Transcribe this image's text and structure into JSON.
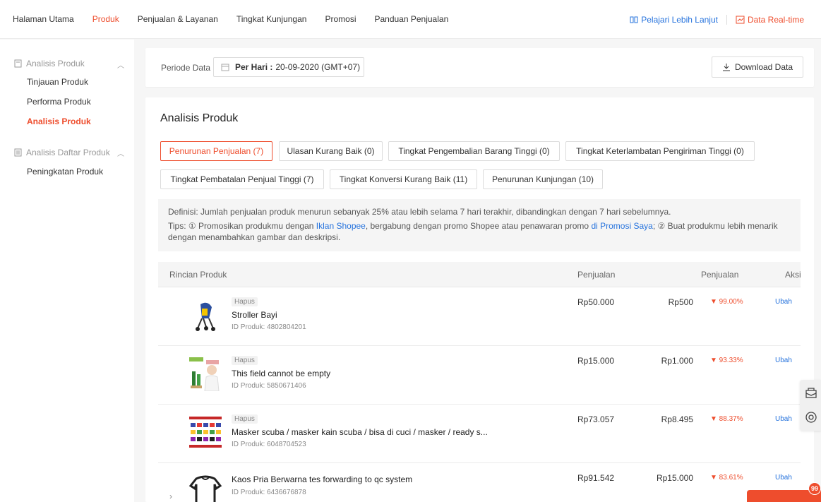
{
  "topnav": {
    "items": [
      "Halaman Utama",
      "Produk",
      "Penjualan & Layanan",
      "Tingkat Kunjungan",
      "Promosi",
      "Panduan Penjualan"
    ],
    "active_index": 1,
    "learn_more": "Pelajari Lebih Lanjut",
    "realtime": "Data Real-time"
  },
  "sidebar": {
    "group1": "Analisis Produk",
    "group1_items": [
      "Tinjauan Produk",
      "Performa Produk",
      "Analisis Produk"
    ],
    "group2": "Analisis Daftar Produk",
    "group2_items": [
      "Peningkatan Produk"
    ]
  },
  "period": {
    "label": "Periode Data",
    "date_label": "Per Hari :",
    "date_value": "20-09-2020 (GMT+07)",
    "download": "Download Data"
  },
  "main": {
    "title": "Analisis Produk",
    "chips": [
      "Penurunan Penjualan (7)",
      "Ulasan Kurang Baik (0)",
      "Tingkat Pengembalian Barang Tinggi (0)",
      "Tingkat Keterlambatan Pengiriman Tinggi (0)",
      "Tingkat Pembatalan Penjual Tinggi (7)",
      "Tingkat Konversi Kurang Baik (11)",
      "Penurunan Kunjungan (10)"
    ],
    "active_chip": 0,
    "definition_label": "Definisi:",
    "definition_text": "Jumlah penjualan produk menurun sebanyak 25% atau lebih selama 7 hari terakhir, dibandingkan dengan 7 hari sebelumnya.",
    "tips_label": "Tips:",
    "tips_part1": "① Promosikan produkmu dengan",
    "tips_link1": "Iklan Shopee",
    "tips_part2": ", bergabung dengan promo Shopee atau penawaran promo",
    "tips_link2": "di Promosi Saya",
    "tips_part3": "; ② Buat produkmu lebih menarik dengan menambahkan gambar dan deskripsi."
  },
  "table": {
    "headers": [
      "Rincian Produk",
      "Penjualan",
      "Penjualan",
      "Aksi"
    ],
    "rows": [
      {
        "badge": "Hapus",
        "name": "Stroller Bayi",
        "id": "ID Produk: 4802804201",
        "sales_prev": "Rp50.000",
        "sales_now": "Rp500",
        "change": "▼ 99.00%",
        "action": "Ubah"
      },
      {
        "badge": "Hapus",
        "name": "This field cannot be empty",
        "id": "ID Produk: 5850671406",
        "sales_prev": "Rp15.000",
        "sales_now": "Rp1.000",
        "change": "▼ 93.33%",
        "action": "Ubah"
      },
      {
        "badge": "Hapus",
        "name": "Masker scuba / masker kain scuba / bisa di cuci / masker / ready s...",
        "id": "ID Produk: 6048704523",
        "sales_prev": "Rp73.057",
        "sales_now": "Rp8.495",
        "change": "▼ 88.37%",
        "action": "Ubah"
      },
      {
        "badge": "",
        "name": "Kaos Pria Berwarna tes forwarding to qc system",
        "id": "ID Produk: 6436676878",
        "sales_prev": "Rp91.542",
        "sales_now": "Rp15.000",
        "change": "▼ 83.61%",
        "action": "Ubah"
      }
    ]
  },
  "chat": {
    "badge_count": "99"
  },
  "colors": {
    "accent": "#ee4d2d",
    "link": "#2673dd"
  }
}
